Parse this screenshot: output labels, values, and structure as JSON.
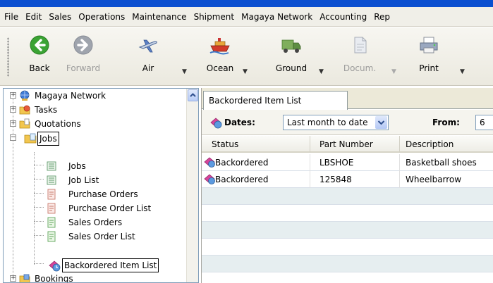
{
  "menu": [
    "File",
    "Edit",
    "Sales",
    "Operations",
    "Maintenance",
    "Shipment",
    "Magaya Network",
    "Accounting",
    "Rep"
  ],
  "toolbar": {
    "back": "Back",
    "forward": "Forward",
    "air": "Air",
    "ocean": "Ocean",
    "ground": "Ground",
    "documents": "Docum.",
    "print": "Print",
    "dropdown_glyph": "▼"
  },
  "tree": {
    "items": [
      {
        "label": "Magaya Network",
        "icon": "network-icon"
      },
      {
        "label": "Tasks",
        "icon": "tasks-icon"
      },
      {
        "label": "Quotations",
        "icon": "quotations-icon"
      },
      {
        "label": "Jobs",
        "icon": "jobs-folder-icon"
      },
      {
        "label": "Jobs",
        "icon": "list-icon"
      },
      {
        "label": "Job List",
        "icon": "list-icon"
      },
      {
        "label": "Purchase Orders",
        "icon": "document-icon"
      },
      {
        "label": "Purchase Order List",
        "icon": "document-icon"
      },
      {
        "label": "Sales Orders",
        "icon": "document-icon"
      },
      {
        "label": "Sales Order List",
        "icon": "document-icon"
      },
      {
        "label": "Backordered Item List",
        "icon": "backorder-icon"
      },
      {
        "label": "Bookings",
        "icon": "bookings-icon"
      }
    ],
    "expand_plus": "+",
    "expand_minus": "−"
  },
  "tab": {
    "label": "Backordered Item List"
  },
  "filter": {
    "dates_label": "Dates:",
    "dates_value": "Last month to date",
    "from_label": "From:",
    "from_value": "6"
  },
  "grid": {
    "columns": [
      "Status",
      "Part Number",
      "Description"
    ],
    "rows": [
      {
        "status": "Backordered",
        "part": "LBSHOE",
        "description": "Basketball shoes"
      },
      {
        "status": "Backordered",
        "part": "125848",
        "description": "Wheelbarrow"
      }
    ]
  },
  "colors": {
    "accent": "#0a4fd0",
    "alt_row": "#e6eef0"
  }
}
